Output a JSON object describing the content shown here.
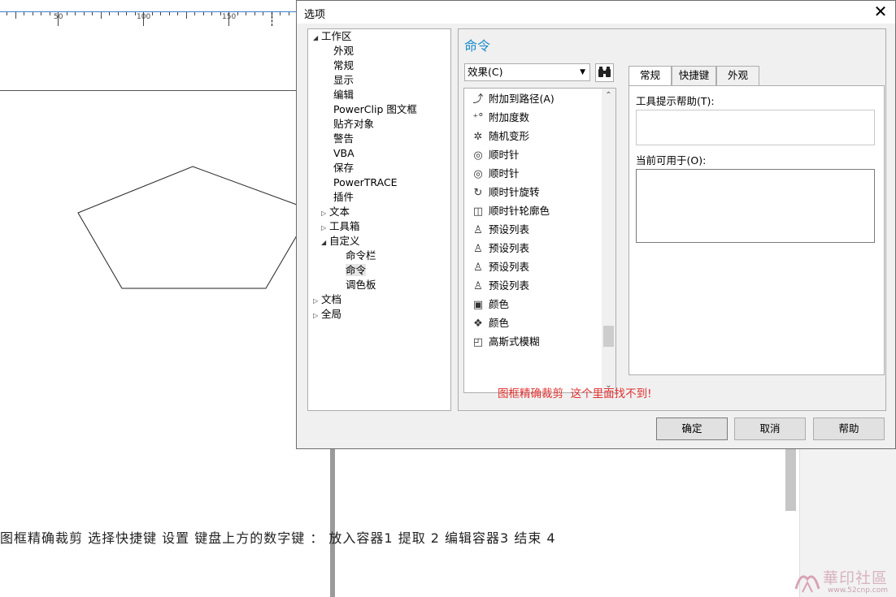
{
  "ruler": {
    "labels": [
      "50",
      "100",
      "150"
    ]
  },
  "canvas_note": "图框精确裁剪 选择快捷键 设置 键盘上方的数字键 ： 放入容器1 提取 2 编辑容器3 结束 4",
  "watermark": {
    "text": "華印社區",
    "url": "www.52cnp.com"
  },
  "dialog": {
    "title": "选项",
    "close_icon": "close-icon",
    "tree": [
      {
        "label": "工作区",
        "arrow": "◢"
      },
      {
        "label": "外观",
        "arrow": ""
      },
      {
        "label": "常规",
        "arrow": ""
      },
      {
        "label": "显示",
        "arrow": ""
      },
      {
        "label": "编辑",
        "arrow": ""
      },
      {
        "label": "PowerClip 图文框",
        "arrow": ""
      },
      {
        "label": "贴齐对象",
        "arrow": ""
      },
      {
        "label": "警告",
        "arrow": ""
      },
      {
        "label": "VBA",
        "arrow": ""
      },
      {
        "label": "保存",
        "arrow": ""
      },
      {
        "label": "PowerTRACE",
        "arrow": ""
      },
      {
        "label": "插件",
        "arrow": ""
      },
      {
        "label": "文本",
        "arrow": "▷"
      },
      {
        "label": "工具箱",
        "arrow": "▷"
      },
      {
        "label": "自定义",
        "arrow": "◢"
      },
      {
        "label": "命令栏",
        "arrow": ""
      },
      {
        "label": "命令",
        "arrow": ""
      },
      {
        "label": "调色板",
        "arrow": ""
      },
      {
        "label": "文档",
        "arrow": "▷"
      },
      {
        "label": "全局",
        "arrow": "▷"
      }
    ],
    "panel_title": "命令",
    "category_select": "效果(C)",
    "find_icon": "binoculars-icon",
    "commands": [
      {
        "label": "附加到路径(A)",
        "icon": "path-attach-icon",
        "glyph": "⤴"
      },
      {
        "label": "附加度数",
        "icon": "degrees-icon",
        "glyph": "⁺°"
      },
      {
        "label": "随机变形",
        "icon": "random-distort-icon",
        "glyph": "✲"
      },
      {
        "label": "顺时针",
        "icon": "clockwise-icon",
        "glyph": "◎"
      },
      {
        "label": "顺时针",
        "icon": "clockwise-icon",
        "glyph": "◎"
      },
      {
        "label": "顺时针旋转",
        "icon": "rotate-clockwise-icon",
        "glyph": "↻"
      },
      {
        "label": "顺时针轮廓色",
        "icon": "outline-color-icon",
        "glyph": "◫"
      },
      {
        "label": "预设列表",
        "icon": "preset-list-icon",
        "glyph": "♙"
      },
      {
        "label": "预设列表",
        "icon": "preset-list-icon",
        "glyph": "♙"
      },
      {
        "label": "预设列表",
        "icon": "preset-list-icon",
        "glyph": "♙"
      },
      {
        "label": "预设列表",
        "icon": "preset-list-icon",
        "glyph": "♙"
      },
      {
        "label": "颜色",
        "icon": "color-icon",
        "glyph": "▣"
      },
      {
        "label": "颜色",
        "icon": "color-cube-icon",
        "glyph": "❖"
      },
      {
        "label": "高斯式模糊",
        "icon": "gaussian-blur-icon",
        "glyph": "◰"
      }
    ],
    "tabs": [
      "常规",
      "快捷键",
      "外观"
    ],
    "active_tab": "常规",
    "tooltip_label": "工具提示帮助(T):",
    "available_label": "当前可用于(O):",
    "annotation": "图框精确裁剪  这个里面找不到!",
    "buttons": {
      "ok": "确定",
      "cancel": "取消",
      "help": "帮助"
    }
  }
}
